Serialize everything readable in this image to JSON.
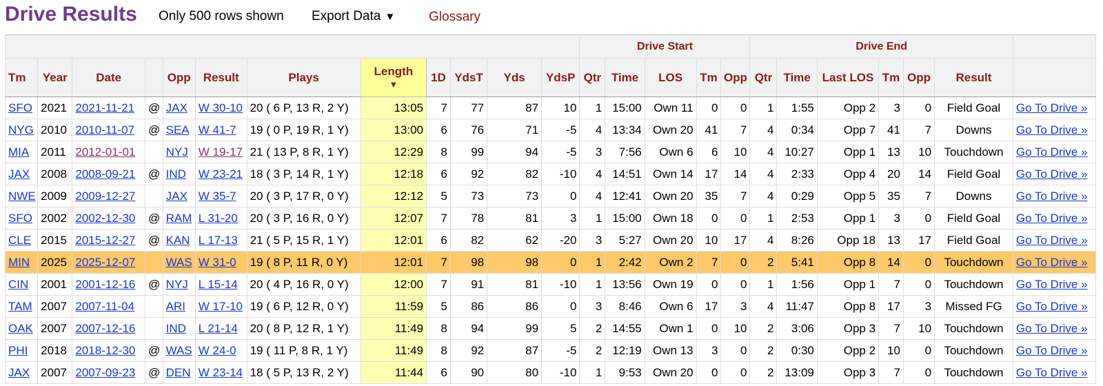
{
  "header": {
    "title": "Drive Results",
    "rows_note": "Only 500 rows shown",
    "export_label": "Export Data",
    "export_caret": "▼",
    "glossary": "Glossary"
  },
  "table": {
    "group_headers": {
      "drive_start": "Drive Start",
      "drive_end": "Drive End"
    },
    "columns": [
      "Tm",
      "Year",
      "Date",
      "",
      "Opp",
      "Result",
      "Plays",
      "Length",
      "1D",
      "YdsT",
      "Yds",
      "YdsP",
      "Qtr",
      "Time",
      "LOS",
      "Tm",
      "Opp",
      "Qtr",
      "Time",
      "Last LOS",
      "Tm",
      "Opp",
      "Result",
      ""
    ],
    "sort_indicator": "▼",
    "rows": [
      {
        "tm": "SFO",
        "year": "2021",
        "date": "2021-11-21",
        "at": "@",
        "opp": "JAX",
        "result": "W 30-10",
        "plays": "20 ( 6 P, 13 R, 2 Y)",
        "length": "13:05",
        "fd": "7",
        "ydst": "77",
        "yds": "87",
        "ydsp": "10",
        "sqtr": "1",
        "stime": "15:00",
        "slos": "Own 11",
        "stm": "0",
        "sopp": "0",
        "eqtr": "1",
        "etime": "1:55",
        "elos": "Opp 2",
        "etm": "3",
        "eopp": "0",
        "eresult": "Field Goal",
        "link": "Go To Drive »",
        "visited": false,
        "highlight": false
      },
      {
        "tm": "NYG",
        "year": "2010",
        "date": "2010-11-07",
        "at": "@",
        "opp": "SEA",
        "result": "W 41-7",
        "plays": "19 ( 0 P, 19 R, 1 Y)",
        "length": "13:00",
        "fd": "6",
        "ydst": "76",
        "yds": "71",
        "ydsp": "-5",
        "sqtr": "4",
        "stime": "13:34",
        "slos": "Own 20",
        "stm": "41",
        "sopp": "7",
        "eqtr": "4",
        "etime": "0:34",
        "elos": "Opp 7",
        "etm": "41",
        "eopp": "7",
        "eresult": "Downs",
        "link": "Go To Drive »",
        "visited": false,
        "highlight": false
      },
      {
        "tm": "MIA",
        "year": "2011",
        "date": "2012-01-01",
        "at": "",
        "opp": "NYJ",
        "result": "W 19-17",
        "plays": "21 ( 13 P, 8 R, 1 Y)",
        "length": "12:29",
        "fd": "8",
        "ydst": "99",
        "yds": "94",
        "ydsp": "-5",
        "sqtr": "3",
        "stime": "7:56",
        "slos": "Own 6",
        "stm": "6",
        "sopp": "10",
        "eqtr": "4",
        "etime": "10:27",
        "elos": "Opp 1",
        "etm": "13",
        "eopp": "10",
        "eresult": "Touchdown",
        "link": "Go To Drive »",
        "visited": true,
        "highlight": false
      },
      {
        "tm": "JAX",
        "year": "2008",
        "date": "2008-09-21",
        "at": "@",
        "opp": "IND",
        "result": "W 23-21",
        "plays": "18 ( 3 P, 14 R, 1 Y)",
        "length": "12:18",
        "fd": "6",
        "ydst": "92",
        "yds": "82",
        "ydsp": "-10",
        "sqtr": "4",
        "stime": "14:51",
        "slos": "Own 14",
        "stm": "17",
        "sopp": "14",
        "eqtr": "4",
        "etime": "2:33",
        "elos": "Opp 4",
        "etm": "20",
        "eopp": "14",
        "eresult": "Field Goal",
        "link": "Go To Drive »",
        "visited": false,
        "highlight": false
      },
      {
        "tm": "NWE",
        "year": "2009",
        "date": "2009-12-27",
        "at": "",
        "opp": "JAX",
        "result": "W 35-7",
        "plays": "20 ( 3 P, 17 R, 0 Y)",
        "length": "12:12",
        "fd": "5",
        "ydst": "73",
        "yds": "73",
        "ydsp": "0",
        "sqtr": "4",
        "stime": "12:41",
        "slos": "Own 20",
        "stm": "35",
        "sopp": "7",
        "eqtr": "4",
        "etime": "0:29",
        "elos": "Opp 5",
        "etm": "35",
        "eopp": "7",
        "eresult": "Downs",
        "link": "Go To Drive »",
        "visited": false,
        "highlight": false
      },
      {
        "tm": "SFO",
        "year": "2002",
        "date": "2002-12-30",
        "at": "@",
        "opp": "RAM",
        "result": "L 31-20",
        "plays": "20 ( 3 P, 16 R, 0 Y)",
        "length": "12:07",
        "fd": "7",
        "ydst": "78",
        "yds": "81",
        "ydsp": "3",
        "sqtr": "1",
        "stime": "15:00",
        "slos": "Own 18",
        "stm": "0",
        "sopp": "0",
        "eqtr": "1",
        "etime": "2:53",
        "elos": "Opp 1",
        "etm": "3",
        "eopp": "0",
        "eresult": "Field Goal",
        "link": "Go To Drive »",
        "visited": false,
        "highlight": false
      },
      {
        "tm": "CLE",
        "year": "2015",
        "date": "2015-12-27",
        "at": "@",
        "opp": "KAN",
        "result": "L 17-13",
        "plays": "21 ( 5 P, 15 R, 1 Y)",
        "length": "12:01",
        "fd": "6",
        "ydst": "82",
        "yds": "62",
        "ydsp": "-20",
        "sqtr": "3",
        "stime": "5:27",
        "slos": "Own 20",
        "stm": "10",
        "sopp": "17",
        "eqtr": "4",
        "etime": "8:26",
        "elos": "Opp 18",
        "etm": "13",
        "eopp": "17",
        "eresult": "Field Goal",
        "link": "Go To Drive »",
        "visited": false,
        "highlight": false
      },
      {
        "tm": "MIN",
        "year": "2025",
        "date": "2025-12-07",
        "at": "",
        "opp": "WAS",
        "result": "W 31-0",
        "plays": "19 ( 8 P, 11 R, 0 Y)",
        "length": "12:01",
        "fd": "7",
        "ydst": "98",
        "yds": "98",
        "ydsp": "0",
        "sqtr": "1",
        "stime": "2:42",
        "slos": "Own 2",
        "stm": "7",
        "sopp": "0",
        "eqtr": "2",
        "etime": "5:41",
        "elos": "Opp 8",
        "etm": "14",
        "eopp": "0",
        "eresult": "Touchdown",
        "link": "Go To Drive »",
        "visited": false,
        "highlight": true
      },
      {
        "tm": "CIN",
        "year": "2001",
        "date": "2001-12-16",
        "at": "@",
        "opp": "NYJ",
        "result": "L 15-14",
        "plays": "20 ( 4 P, 16 R, 0 Y)",
        "length": "12:00",
        "fd": "7",
        "ydst": "91",
        "yds": "81",
        "ydsp": "-10",
        "sqtr": "1",
        "stime": "13:56",
        "slos": "Own 19",
        "stm": "0",
        "sopp": "0",
        "eqtr": "1",
        "etime": "1:56",
        "elos": "Opp 1",
        "etm": "7",
        "eopp": "0",
        "eresult": "Touchdown",
        "link": "Go To Drive »",
        "visited": false,
        "highlight": false
      },
      {
        "tm": "TAM",
        "year": "2007",
        "date": "2007-11-04",
        "at": "",
        "opp": "ARI",
        "result": "W 17-10",
        "plays": "19 ( 6 P, 12 R, 0 Y)",
        "length": "11:59",
        "fd": "5",
        "ydst": "86",
        "yds": "86",
        "ydsp": "0",
        "sqtr": "3",
        "stime": "8:46",
        "slos": "Own 6",
        "stm": "17",
        "sopp": "3",
        "eqtr": "4",
        "etime": "11:47",
        "elos": "Opp 8",
        "etm": "17",
        "eopp": "3",
        "eresult": "Missed FG",
        "link": "Go To Drive »",
        "visited": false,
        "highlight": false
      },
      {
        "tm": "OAK",
        "year": "2007",
        "date": "2007-12-16",
        "at": "",
        "opp": "IND",
        "result": "L 21-14",
        "plays": "20 ( 8 P, 12 R, 1 Y)",
        "length": "11:49",
        "fd": "8",
        "ydst": "94",
        "yds": "99",
        "ydsp": "5",
        "sqtr": "2",
        "stime": "14:55",
        "slos": "Own 1",
        "stm": "0",
        "sopp": "10",
        "eqtr": "2",
        "etime": "3:06",
        "elos": "Opp 3",
        "etm": "7",
        "eopp": "10",
        "eresult": "Touchdown",
        "link": "Go To Drive »",
        "visited": false,
        "highlight": false
      },
      {
        "tm": "PHI",
        "year": "2018",
        "date": "2018-12-30",
        "at": "@",
        "opp": "WAS",
        "result": "W 24-0",
        "plays": "19 ( 11 P, 8 R, 1 Y)",
        "length": "11:49",
        "fd": "8",
        "ydst": "92",
        "yds": "87",
        "ydsp": "-5",
        "sqtr": "2",
        "stime": "12:19",
        "slos": "Own 13",
        "stm": "3",
        "sopp": "0",
        "eqtr": "2",
        "etime": "0:30",
        "elos": "Opp 2",
        "etm": "10",
        "eopp": "0",
        "eresult": "Touchdown",
        "link": "Go To Drive »",
        "visited": false,
        "highlight": false
      },
      {
        "tm": "JAX",
        "year": "2007",
        "date": "2007-09-23",
        "at": "@",
        "opp": "DEN",
        "result": "W 23-14",
        "plays": "18 ( 5 P, 13 R, 2 Y)",
        "length": "11:44",
        "fd": "6",
        "ydst": "90",
        "yds": "80",
        "ydsp": "-10",
        "sqtr": "1",
        "stime": "9:53",
        "slos": "Own 20",
        "stm": "0",
        "sopp": "0",
        "eqtr": "2",
        "etime": "13:09",
        "elos": "Opp 3",
        "etm": "7",
        "eopp": "0",
        "eresult": "Touchdown",
        "link": "Go To Drive »",
        "visited": false,
        "highlight": false
      }
    ]
  },
  "colors": {
    "title": "#6d3b8e",
    "header_text": "#8b1a1a",
    "link": "#1a36d8",
    "visited_link": "#8a3072",
    "sorted_column": "#ffff99",
    "highlight_row": "#fdc96a"
  }
}
